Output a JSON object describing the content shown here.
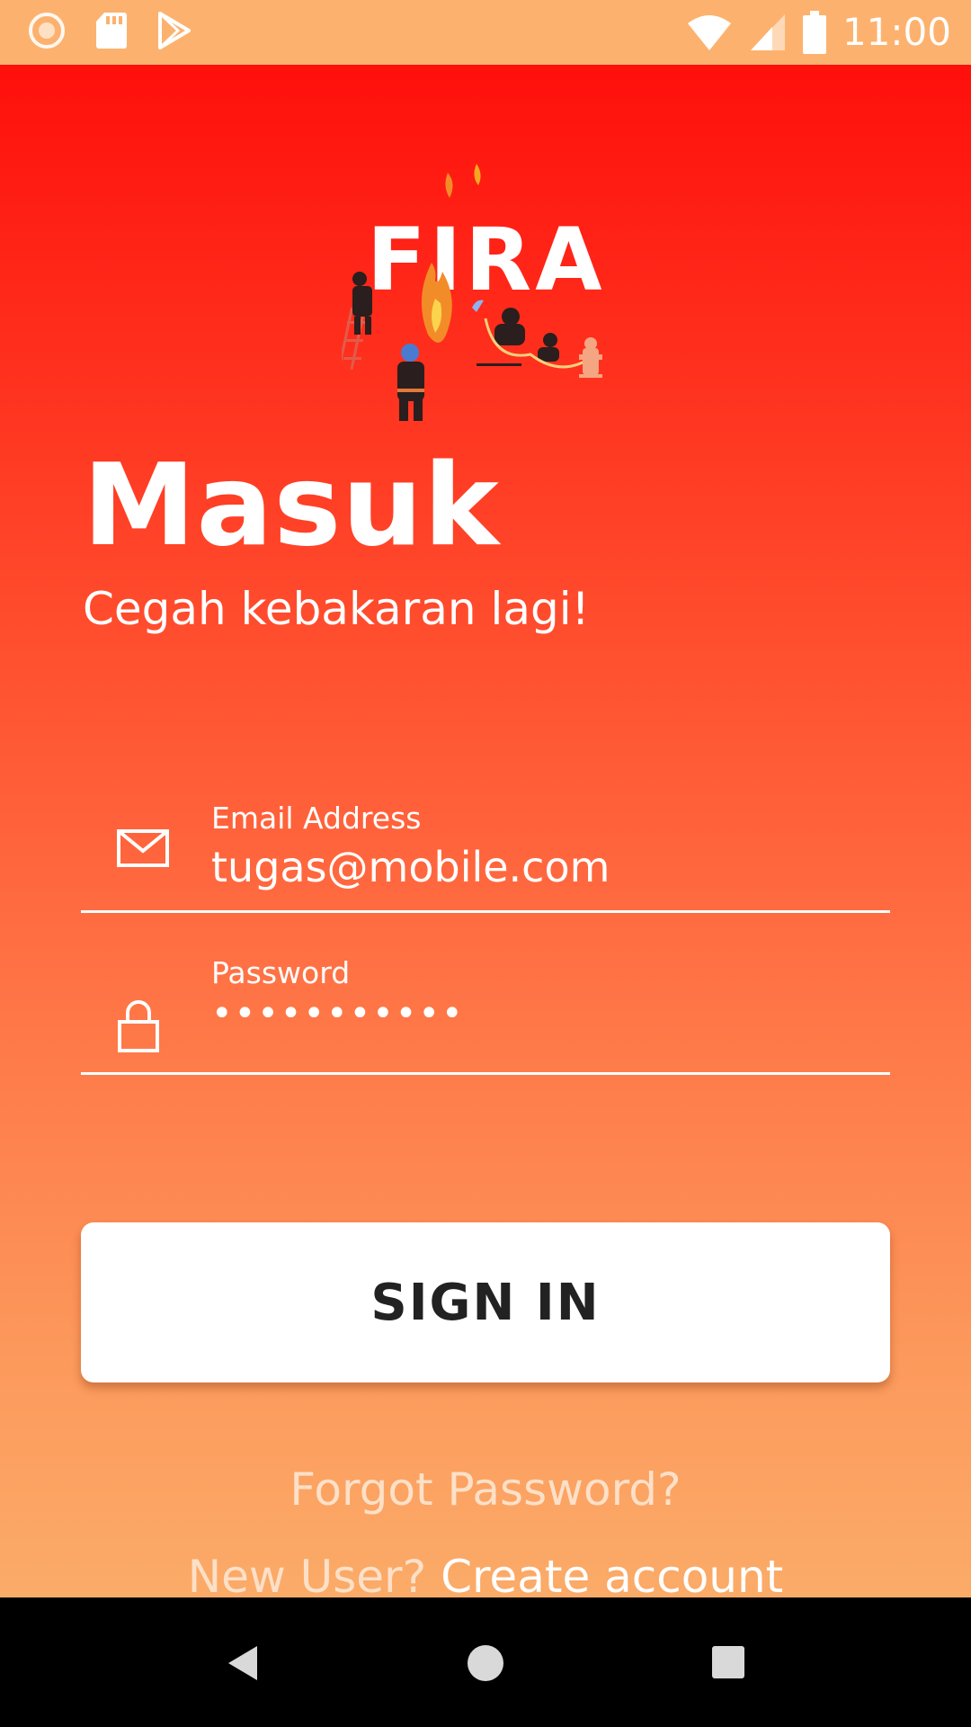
{
  "status_bar": {
    "time": "11:00",
    "left_icons": [
      "loading-icon",
      "sd-card-icon",
      "play-store-icon"
    ],
    "right_icons": [
      "wifi-icon",
      "cell-signal-icon",
      "battery-icon"
    ]
  },
  "logo": {
    "text": "FIRA"
  },
  "login": {
    "title": "Masuk",
    "subtitle": "Cegah kebakaran lagi!",
    "email_label": "Email Address",
    "email_value": "tugas@mobile.com",
    "password_label": "Password",
    "password_value": "•••••••••••",
    "signin_label": "SIGN IN",
    "forgot_label": "Forgot Password?",
    "new_user_label": "New User?",
    "create_account_label": "Create account"
  },
  "colors": {
    "status_bar": "#FCB26E",
    "gradient_top": "#FF0F0B",
    "gradient_bottom": "#FBAB68",
    "button_bg": "#FFFFFF",
    "button_text": "#222222",
    "link_muted": "#FDE0C8"
  },
  "nav_bar": {
    "buttons": [
      "back-icon",
      "home-icon",
      "recents-icon"
    ]
  }
}
